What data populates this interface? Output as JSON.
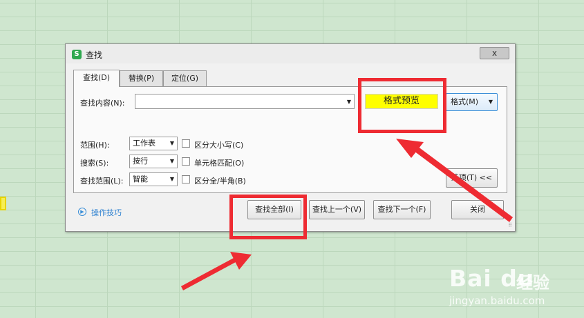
{
  "dialog": {
    "title": "查找",
    "close_glyph": "x",
    "icon_letter": "S",
    "tabs": [
      {
        "label": "查找(D)"
      },
      {
        "label": "替换(P)"
      },
      {
        "label": "定位(G)"
      }
    ],
    "find_what_label": "查找内容(N):",
    "find_what_value": "",
    "format_preview_text": "格式预览",
    "format_button": "格式(M)",
    "options": [
      {
        "label": "范围(H):",
        "value": "工作表",
        "checkbox_label": "区分大小写(C)"
      },
      {
        "label": "搜索(S):",
        "value": "按行",
        "checkbox_label": "单元格匹配(O)"
      },
      {
        "label": "查找范围(L):",
        "value": "智能",
        "checkbox_label": "区分全/半角(B)"
      }
    ],
    "options_toggle_button": "选项(T) <<",
    "tips_link": "操作技巧",
    "buttons": {
      "find_all": "查找全部(I)",
      "find_prev": "查找上一个(V)",
      "find_next": "查找下一个(F)",
      "close": "关闭"
    }
  },
  "annotation_color": "#ee2b32",
  "preview_color": "#ffff00",
  "watermark": {
    "logo": "Bai  du",
    "chinese": "经验",
    "url": "jingyan.baidu.com"
  }
}
